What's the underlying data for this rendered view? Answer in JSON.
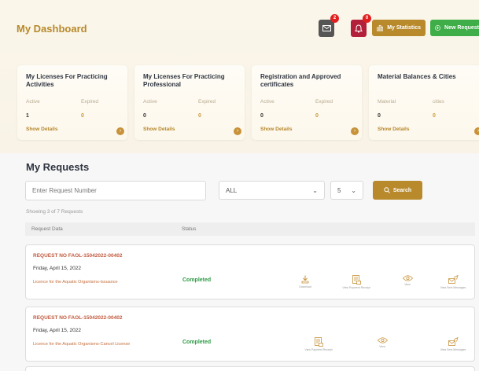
{
  "header": {
    "title": "My Dashboard",
    "mail_badge": "2",
    "notification_badge": "0",
    "statistics_label": "My Statistics",
    "new_request_label": "New Request"
  },
  "cards": [
    {
      "title": "My Licenses For Practicing Activities",
      "label1": "Active",
      "label2": "Expired",
      "value1": "1",
      "value2": "0",
      "link": "Show Details"
    },
    {
      "title": "My Licenses For Practicing Professional",
      "label1": "Active",
      "label2": "Expired",
      "value1": "0",
      "value2": "0",
      "link": "Show Details"
    },
    {
      "title": "Registration and Approved certificates",
      "label1": "Active",
      "label2": "Expired",
      "value1": "0",
      "value2": "0",
      "link": "Show Details"
    },
    {
      "title": "Material Balances & Cities",
      "label1": "Material",
      "label2": "cities",
      "value1": "0",
      "value2": "0",
      "link": "Show Details"
    }
  ],
  "requests": {
    "title": "My Requests",
    "search_placeholder": "Enter Request Number",
    "filter_value": "ALL",
    "page_size": "5",
    "search_label": "Search",
    "showing_text": "Showing 3 of 7 Requests",
    "col_data": "Request Data",
    "col_status": "Status",
    "rows": [
      {
        "number": "REQUEST NO FAOL-15042022-00402",
        "date": "Friday, April 15, 2022",
        "license": "Licence for the Aquatic Organisms-Issuance",
        "status": "Completed",
        "actions": [
          "Download",
          "View Payment Receipt",
          "View",
          "View Sent Messages"
        ]
      },
      {
        "number": "REQUEST NO FAOL-15042022-00402",
        "date": "Friday, April 15, 2022",
        "license": "Licence for the Aquatic Organisms-Cancel License",
        "status": "Completed",
        "actions": [
          "View Payment Receipt",
          "View",
          "View Sent Messages"
        ]
      }
    ]
  },
  "colors": {
    "gold": "#b88a2c",
    "green": "#3fae49",
    "red": "#b3203a",
    "status_green": "#2e9b45"
  }
}
